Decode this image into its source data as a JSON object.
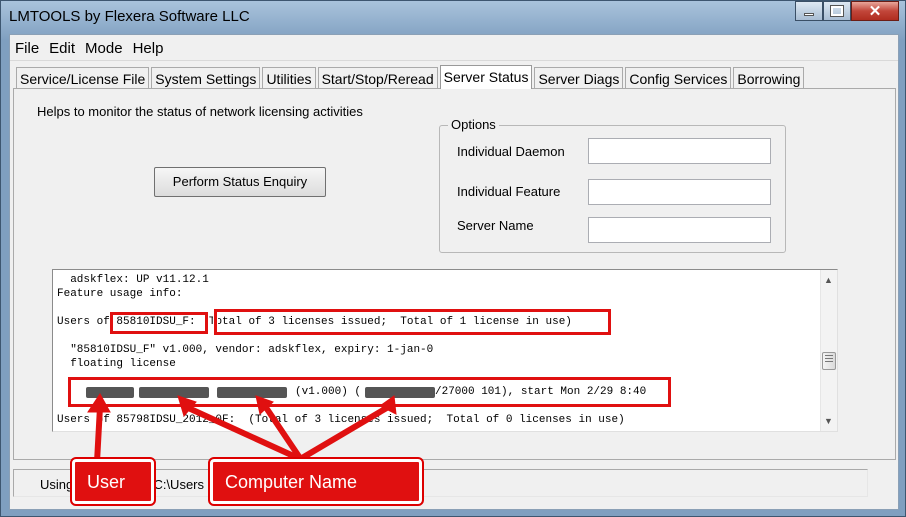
{
  "window": {
    "title": "LMTOOLS by Flexera Software LLC"
  },
  "caption_buttons": {
    "minimize": "minimize-icon",
    "maximize": "maximize-icon",
    "close_glyph": "✕"
  },
  "menu": [
    "File",
    "Edit",
    "Mode",
    "Help"
  ],
  "tabs": [
    "Service/License File",
    "System Settings",
    "Utilities",
    "Start/Stop/Reread",
    "Server Status",
    "Server Diags",
    "Config Services",
    "Borrowing"
  ],
  "active_tab": "Server Status",
  "page": {
    "help_text": "Helps to monitor the status of network licensing activities",
    "enquiry_button": "Perform Status Enquiry",
    "options": {
      "legend": "Options",
      "daemon_label": "Individual Daemon",
      "daemon_value": "",
      "feature_label": "Individual Feature",
      "feature_value": "",
      "server_label": "Server Name",
      "server_value": ""
    }
  },
  "log": {
    "line1": "  adskflex: UP v11.12.1",
    "line2": "Feature usage info:",
    "line3a": "Users of ",
    "line3b": "85810IDSU_F:",
    "line3c": "  Total of 3 licenses issued;  Total of 1 license in use)",
    "line4": "  \"85810IDSU_F\" v1.000, vendor: adskflex, expiry: 1-jan-0",
    "line5": "  floating license",
    "line6a": "(v1.000) (",
    "line6b": "/27000 101), start Mon 2/29 8:40",
    "line7": "Users of 85798IDSU_2012_0F:  (Total of 3 licenses issued;  Total of 0 licenses in use)"
  },
  "status_bar": {
    "text": "Using License File: C:\\Users"
  },
  "annotations": {
    "user_label": "User",
    "computer_label": "Computer Name"
  },
  "colors": {
    "annotation_red": "#e01010",
    "titlebar_blue": "#7f9fc0"
  }
}
